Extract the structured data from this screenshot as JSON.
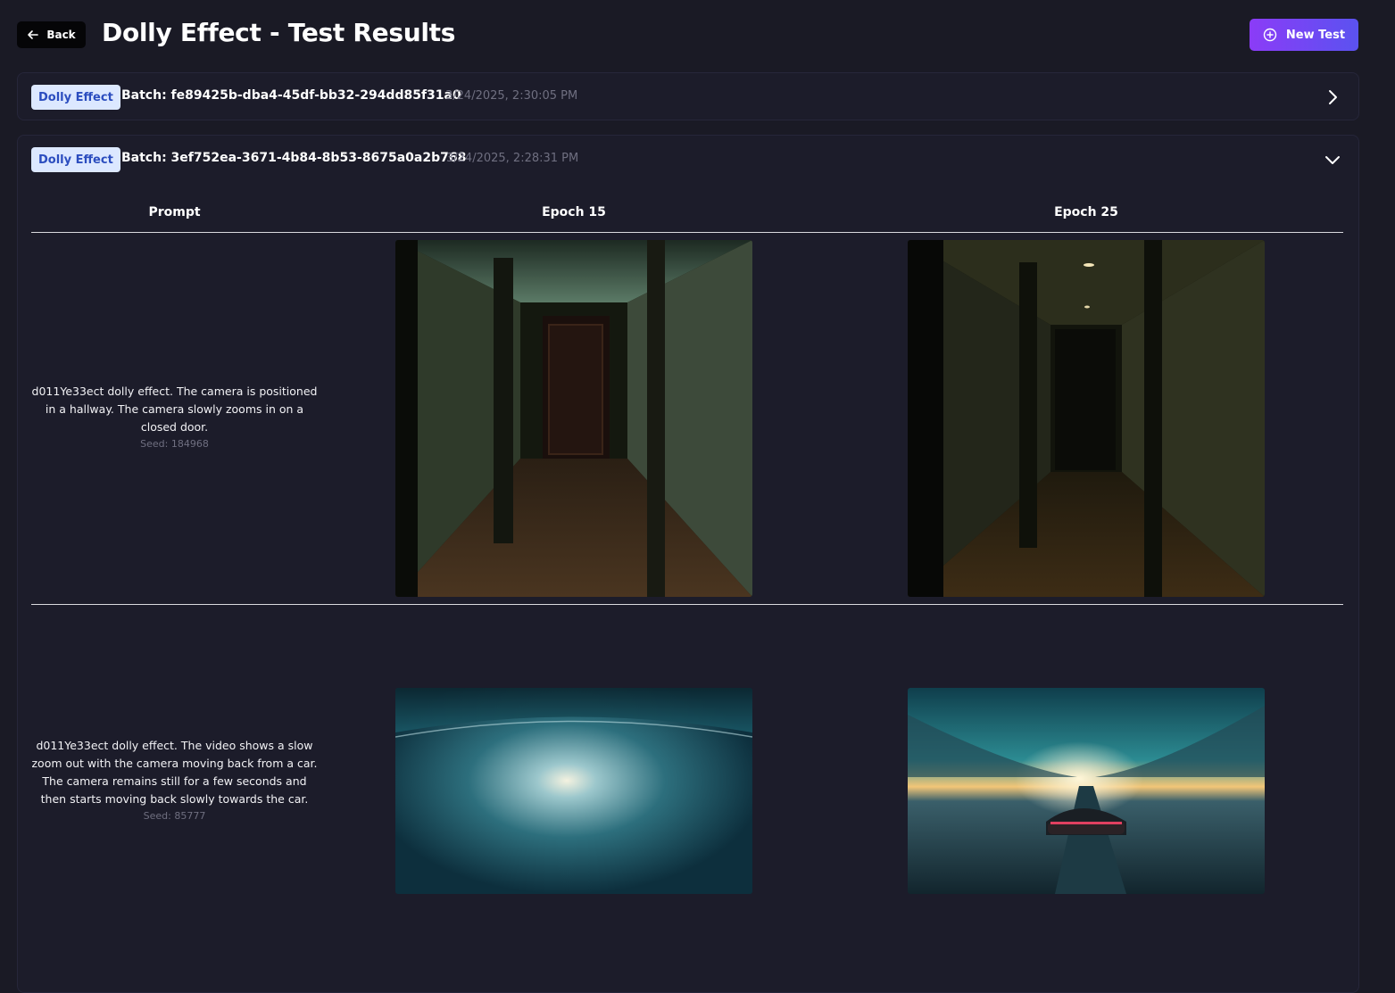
{
  "header": {
    "back_label": "Back",
    "title": "Dolly Effect - Test Results",
    "new_test_label": "New Test"
  },
  "batches": [
    {
      "tag": "Dolly Effect",
      "batch_label": "Batch: fe89425b-dba4-45df-bb32-294dd85f31a0",
      "timestamp": "3/24/2025, 2:30:05 PM",
      "expanded": false
    },
    {
      "tag": "Dolly Effect",
      "batch_label": "Batch: 3ef752ea-3671-4b84-8b53-8675a0a2b768",
      "timestamp": "3/24/2025, 2:28:31 PM",
      "expanded": true,
      "columns": [
        "Prompt",
        "Epoch 15",
        "Epoch 25"
      ],
      "rows": [
        {
          "prompt": "d011Ye33ect dolly effect. The camera is positioned in a hallway. The camera slowly zooms in on a closed door.",
          "seed": "Seed: 184968"
        },
        {
          "prompt": "d011Ye33ect dolly effect. The video shows a slow zoom out with the camera moving back from a car. The camera remains still for a few seconds and then starts moving back slowly towards the car.",
          "seed": "Seed: 85777"
        }
      ]
    }
  ],
  "colors": {
    "background": "#1a1a25",
    "accent_gradient_start": "#8b3cf7",
    "accent_gradient_end": "#5b52f0",
    "badge_bg": "#dce8ff",
    "badge_text": "#2b4dbf"
  },
  "icons": {
    "back": "arrow-left-icon",
    "new_test": "plus-circle-icon",
    "collapsed": "chevron-right-icon",
    "expanded": "chevron-down-icon"
  }
}
